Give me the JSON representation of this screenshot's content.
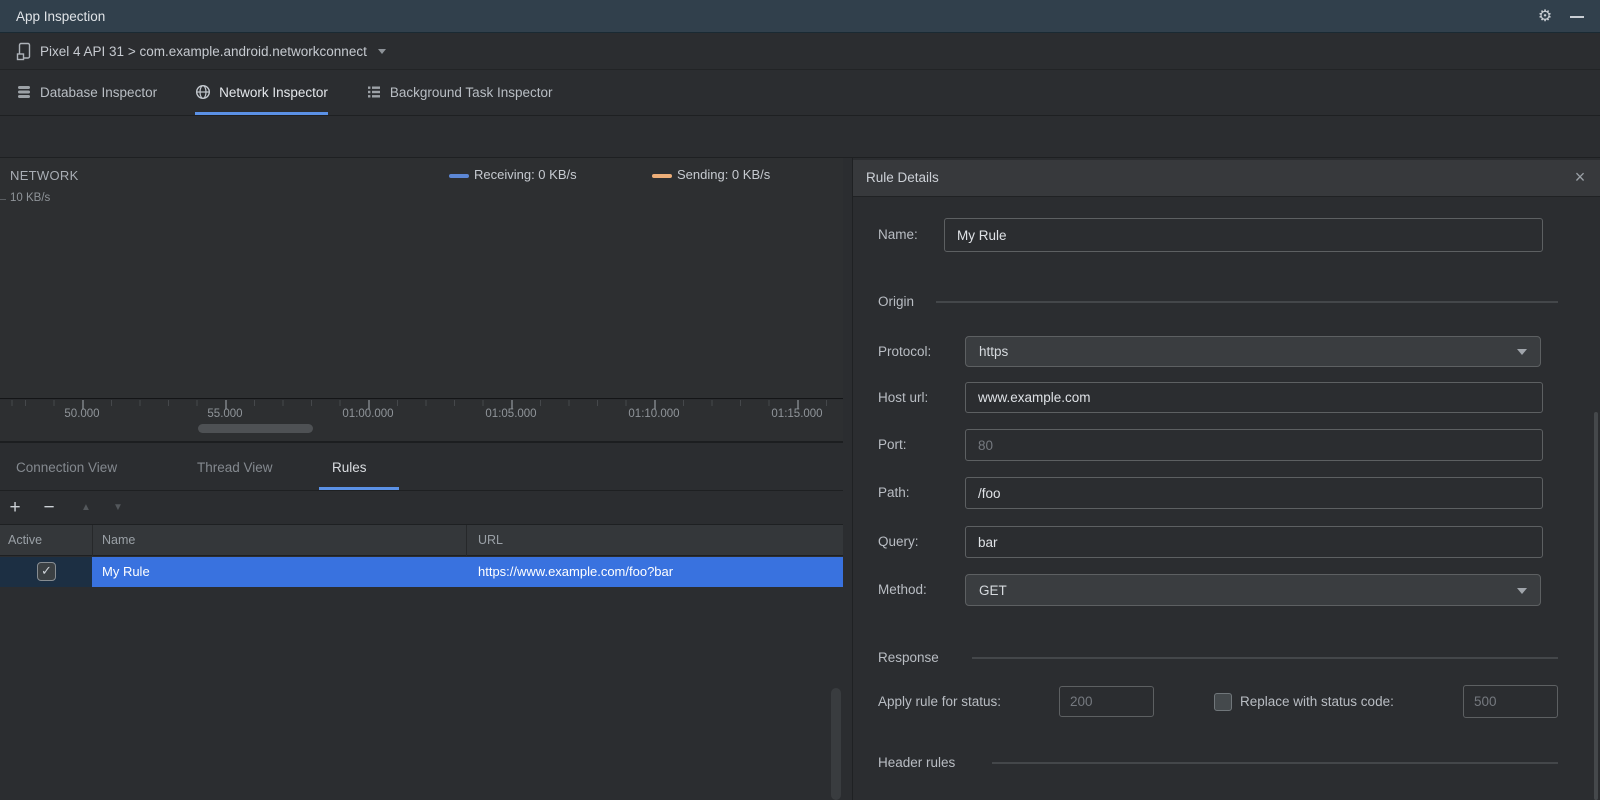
{
  "window": {
    "title": "App Inspection",
    "gear_glyph": "⚙",
    "close_glyph": "×"
  },
  "device_bar": {
    "device": "Pixel 4 API 31",
    "separator": " > ",
    "app_package": "com.example.android.networkconnect"
  },
  "inspector_tabs": [
    {
      "label": "Database Inspector",
      "active": false
    },
    {
      "label": "Network Inspector",
      "active": true
    },
    {
      "label": "Background Task Inspector",
      "active": false
    }
  ],
  "timeline_toolbar": {
    "icons": [
      "zoom-out",
      "zoom-in",
      "reset-zoom",
      "zoom-to-selection",
      "jump-to-live"
    ]
  },
  "network_chart": {
    "title": "NETWORK",
    "y_tick": "10 KB/s",
    "legend": [
      {
        "label": "Receiving: 0 KB/s",
        "color": "#5C87D5"
      },
      {
        "label": "Sending: 0 KB/s",
        "color": "#EDAE78"
      }
    ],
    "x_ticks": [
      "50.000",
      "55.000",
      "01:00.000",
      "01:05.000",
      "01:10.000",
      "01:15.000"
    ]
  },
  "chart_data": {
    "type": "line",
    "title": "NETWORK",
    "x_tick_labels": [
      "50.000",
      "55.000",
      "01:00.000",
      "01:05.000",
      "01:10.000",
      "01:15.000"
    ],
    "y_axis_ticks": [
      "10 KB/s"
    ],
    "ylim_kbps": [
      0,
      10
    ],
    "legend_position": "top-right",
    "series": [
      {
        "name": "Receiving",
        "current_value_kbps": 0,
        "color": "#5C87D5"
      },
      {
        "name": "Sending",
        "current_value_kbps": 0,
        "color": "#EDAE78"
      }
    ]
  },
  "view_tabs": [
    {
      "label": "Connection View",
      "active": false
    },
    {
      "label": "Thread View",
      "active": false
    },
    {
      "label": "Rules",
      "active": true
    }
  ],
  "rules_toolbar": {
    "add": "+",
    "remove": "−",
    "move_up": "▲",
    "move_down": "▼"
  },
  "rules_table": {
    "columns": [
      "Active",
      "Name",
      "URL"
    ],
    "checkmark": "✓",
    "rows": [
      {
        "active": true,
        "name": "My Rule",
        "url": "https://www.example.com/foo?bar",
        "selected": true
      }
    ]
  },
  "rule_details": {
    "title": "Rule Details",
    "name": {
      "label": "Name:",
      "value": "My Rule"
    },
    "origin_section": "Origin",
    "protocol": {
      "label": "Protocol:",
      "value": "https"
    },
    "host": {
      "label": "Host url:",
      "value": "www.example.com"
    },
    "port": {
      "label": "Port:",
      "placeholder": "80"
    },
    "path": {
      "label": "Path:",
      "value": "/foo"
    },
    "query": {
      "label": "Query:",
      "value": "bar"
    },
    "method": {
      "label": "Method:",
      "value": "GET"
    },
    "response_section": "Response",
    "apply_status": {
      "label": "Apply rule for status:",
      "placeholder": "200"
    },
    "replace_status": {
      "label": "Replace with status code:",
      "placeholder": "500",
      "checked": false
    },
    "header_rules_section": "Header rules"
  },
  "colors": {
    "titlebar": "#31404C",
    "selection_blue": "#3972DF",
    "selected_active_cell": "#1C2F43",
    "tab_underline": "#5B91E6",
    "receiving": "#5C87D5",
    "sending": "#EDAE78"
  }
}
